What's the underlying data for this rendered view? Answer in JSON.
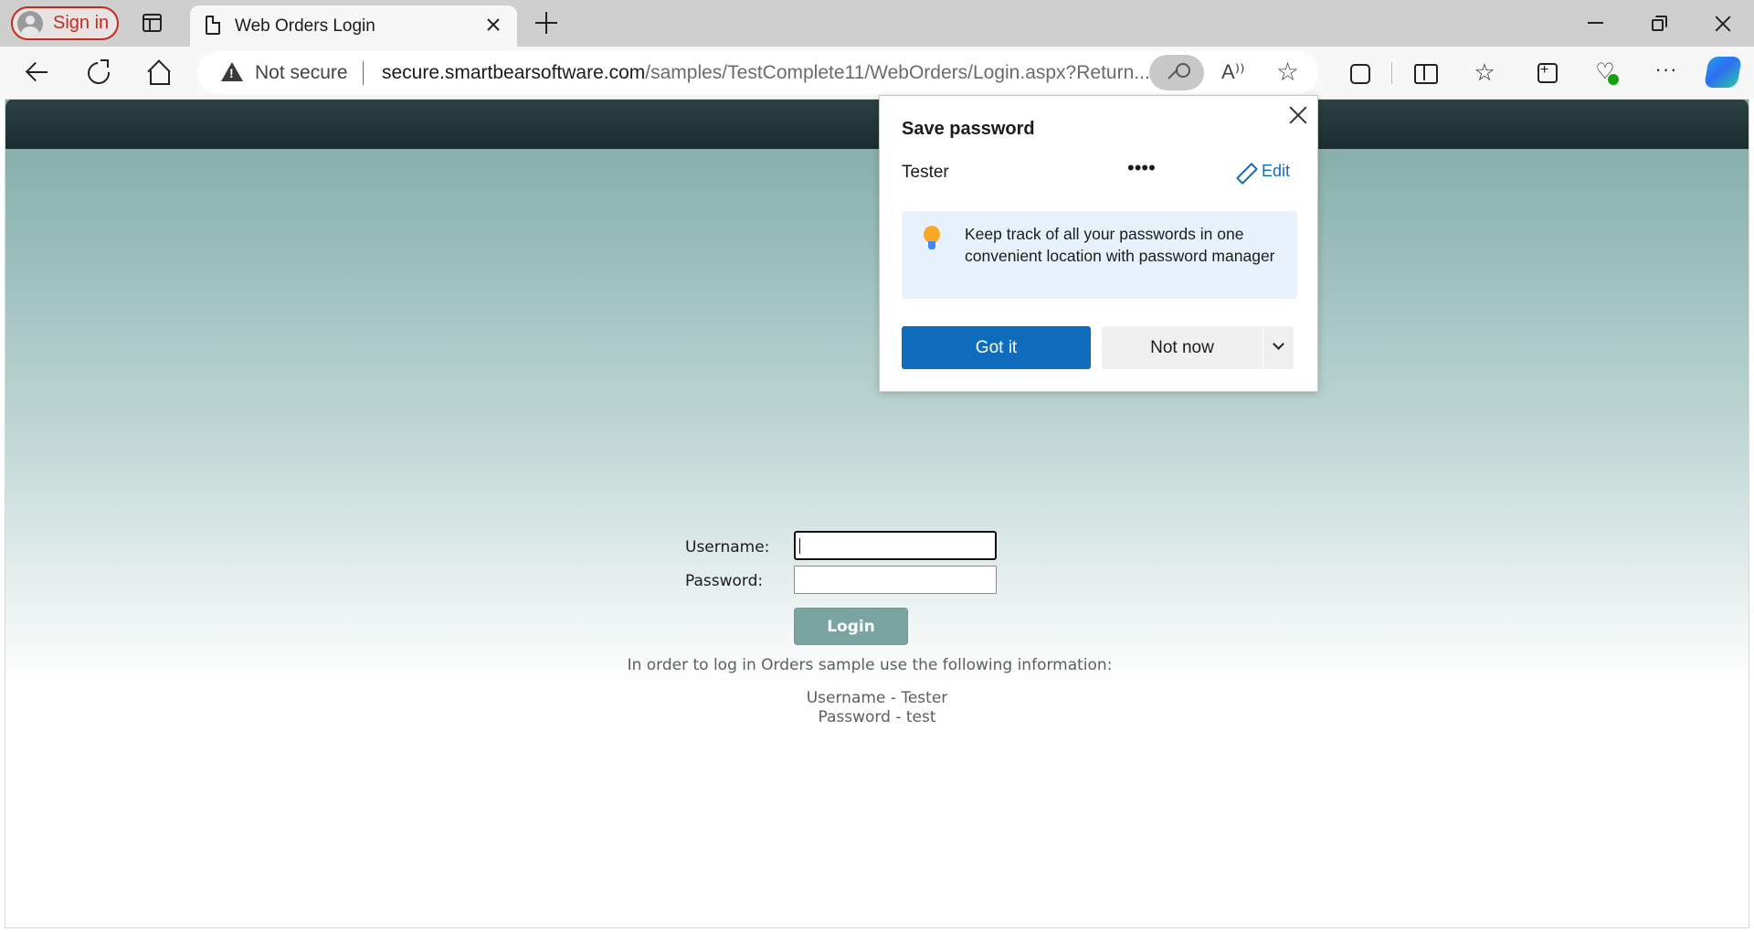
{
  "browser": {
    "profile_label": "Sign in",
    "tab_title": "Web Orders Login",
    "security_label": "Not secure",
    "url_host": "secure.smartbearsoftware.com",
    "url_path": "/samples/TestComplete11/WebOrders/Login.aspx?Return..."
  },
  "login": {
    "username_label": "Username:",
    "password_label": "Password:",
    "username_value": "",
    "password_value": "",
    "login_button": "Login",
    "info_text": "In order to log in Orders sample use the following information:",
    "info_username": "Username - Tester",
    "info_password": "Password - test"
  },
  "save_password_popup": {
    "title": "Save password",
    "saved_username": "Tester",
    "masked_password": "••••",
    "edit_label": "Edit",
    "tip": "Keep track of all your passwords in one convenient location with password manager",
    "primary_button": "Got it",
    "secondary_button": "Not now"
  },
  "icons": [
    "user-avatar-icon",
    "tab-actions-icon",
    "page-icon",
    "close-icon",
    "new-tab-icon",
    "minimize-icon",
    "restore-icon",
    "back-icon",
    "refresh-icon",
    "home-icon",
    "warning-icon",
    "key-icon",
    "read-aloud-icon",
    "favorite-star-icon",
    "extensions-icon",
    "split-screen-icon",
    "favorites-icon",
    "collections-icon",
    "browser-essentials-icon",
    "more-icon",
    "copilot-icon",
    "pencil-icon",
    "lightbulb-icon",
    "chevron-down-icon"
  ],
  "colors": {
    "accent_blue": "#0f6cbd",
    "profile_red": "#c42b1c",
    "header_dark": "#1c2d2f",
    "login_button": "#7aa4a1"
  }
}
